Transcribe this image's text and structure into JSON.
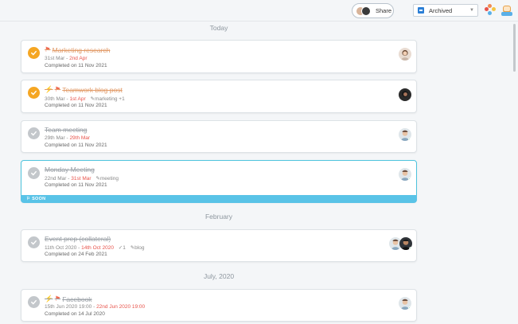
{
  "topbar": {
    "share_label": "Share",
    "filter_label": "Archived",
    "filter_icon": "archive-icon",
    "app_icon": "flower-icon",
    "profile_icon": "robot-avatar-icon"
  },
  "sections": {
    "today": "Today",
    "february": "February",
    "july": "July, 2020"
  },
  "tasks": [
    {
      "title": "Marketing research",
      "start": "31st Mar",
      "sep": " - ",
      "due": "2nd Apr",
      "tags": [],
      "completed": "Completed on 11 Nov 2021",
      "flag": true,
      "bolt": false,
      "status": "orange"
    },
    {
      "title": "Teamwork blog post",
      "start": "30th Mar",
      "sep": " - ",
      "due": "1st Apr",
      "tags": [
        "marketing",
        "+1"
      ],
      "completed": "Completed on 11 Nov 2021",
      "flag": true,
      "bolt": true,
      "status": "orange"
    },
    {
      "title": "Team meeting",
      "start": "29th Mar",
      "sep": " - ",
      "due": "29th Mar",
      "tags": [],
      "completed": "Completed on 11 Nov 2021",
      "flag": false,
      "bolt": false,
      "status": "gray"
    },
    {
      "title": "Monday Meeting",
      "start": "22nd Mar",
      "sep": " - ",
      "due": "31st Mar",
      "tags": [
        "meeting"
      ],
      "completed": "Completed on 11 Nov 2021",
      "flag": false,
      "bolt": false,
      "status": "gray",
      "banner": "SOON"
    },
    {
      "title": "Event prep (collateral)",
      "start": "11th Oct 2020",
      "sep": " - ",
      "due": "14th Oct 2020",
      "subtasks": "1",
      "tags": [
        "blog"
      ],
      "completed": "Completed on 24 Feb 2021",
      "flag": false,
      "bolt": false,
      "status": "gray"
    },
    {
      "title": "Facebook",
      "start": "15th Jun 2020 19:00",
      "sep": " - ",
      "due": "22nd Jun 2020 19:00",
      "tags": [],
      "completed": "Completed on 14 Jul 2020",
      "flag": true,
      "bolt": true,
      "status": "gray"
    }
  ],
  "colors": {
    "accent_orange": "#f5a623",
    "due_red": "#e8534b",
    "highlight": "#4ec3dd",
    "soon_banner": "#59c3e7"
  }
}
